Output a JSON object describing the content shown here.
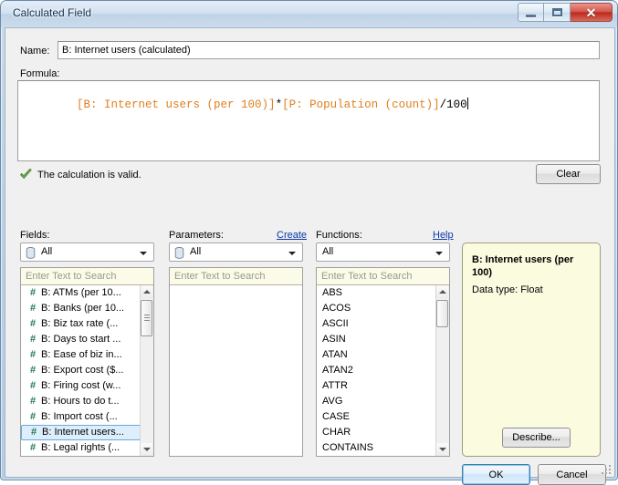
{
  "window": {
    "title": "Calculated Field",
    "buttons": {
      "minimize": "minimize-button",
      "restore": "restore-button",
      "close_glyph": "✕"
    }
  },
  "form": {
    "name_label": "Name:",
    "name_value": "B: Internet users (calculated)",
    "formula_label": "Formula:",
    "formula_parts": [
      {
        "text": "[B: Internet users (per 100)]",
        "kind": "field"
      },
      {
        "text": "*",
        "kind": "op"
      },
      {
        "text": "[P: Population (count)]",
        "kind": "field"
      },
      {
        "text": "/100",
        "kind": "op"
      }
    ],
    "formula_plain": "[B: Internet users (per 100)]*[P: Population (count)]/100",
    "validation_text": "The calculation is valid.",
    "validation_state": "valid",
    "clear_label": "Clear"
  },
  "fields_column": {
    "label": "Fields:",
    "dropdown_value": "All",
    "search_placeholder": "Enter Text to Search",
    "items": [
      {
        "icon": "#",
        "label": "B: ATMs (per 10..."
      },
      {
        "icon": "#",
        "label": "B: Banks (per 10..."
      },
      {
        "icon": "#",
        "label": "B: Biz tax rate (..."
      },
      {
        "icon": "#",
        "label": "B: Days to start ..."
      },
      {
        "icon": "#",
        "label": "B: Ease of biz in..."
      },
      {
        "icon": "#",
        "label": "B: Export cost ($..."
      },
      {
        "icon": "#",
        "label": "B: Firing cost (w..."
      },
      {
        "icon": "#",
        "label": "B: Hours to do t..."
      },
      {
        "icon": "#",
        "label": "B: Import cost (..."
      },
      {
        "icon": "#",
        "label": "B: Internet users...",
        "selected": true
      },
      {
        "icon": "#",
        "label": "B: Legal rights (..."
      }
    ]
  },
  "parameters_column": {
    "label": "Parameters:",
    "create_link": "Create",
    "dropdown_value": "All",
    "search_placeholder": "Enter Text to Search",
    "items": []
  },
  "functions_column": {
    "label": "Functions:",
    "help_link": "Help",
    "dropdown_value": "All",
    "search_placeholder": "Enter Text to Search",
    "items": [
      {
        "label": "ABS"
      },
      {
        "label": "ACOS"
      },
      {
        "label": "ASCII"
      },
      {
        "label": "ASIN"
      },
      {
        "label": "ATAN"
      },
      {
        "label": "ATAN2"
      },
      {
        "label": "ATTR"
      },
      {
        "label": "AVG"
      },
      {
        "label": "CASE"
      },
      {
        "label": "CHAR"
      },
      {
        "label": "CONTAINS"
      }
    ]
  },
  "info_panel": {
    "title": "B: Internet users (per 100)",
    "data_type": "Data type: Float",
    "describe_label": "Describe..."
  },
  "footer": {
    "ok_label": "OK",
    "cancel_label": "Cancel"
  },
  "colors": {
    "formula_field_token": "#e08020",
    "valid_check": "#5a9e3a",
    "link": "#0b38a8",
    "selection_bg": "#ddeefc",
    "selection_border": "#6aa9d8",
    "info_bg": "#fbfbe0",
    "search_bg": "#fbfbe8",
    "field_icon": "#1f7a4d",
    "close_button": "#bb2a1d"
  }
}
